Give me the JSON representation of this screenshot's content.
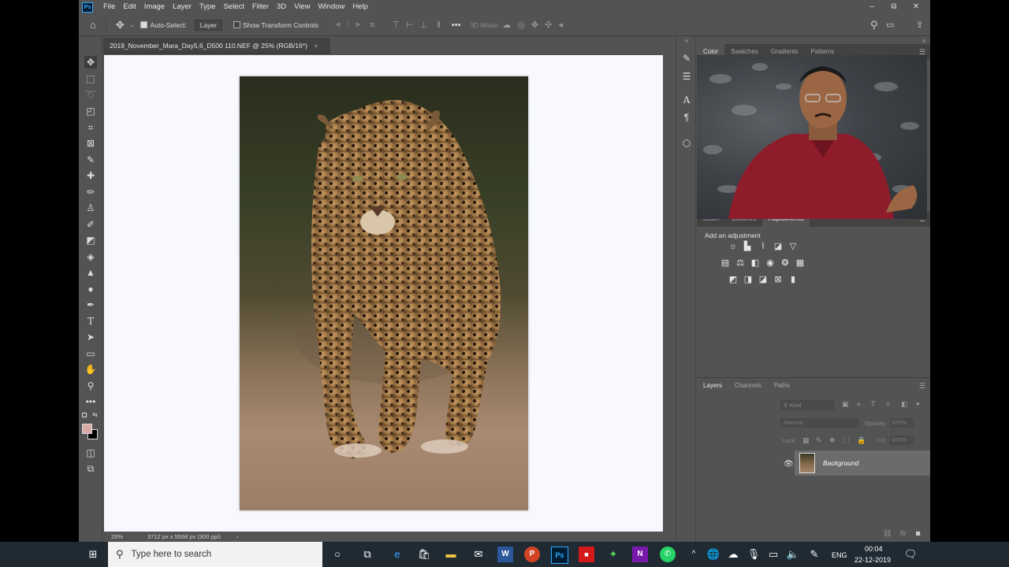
{
  "app": {
    "logo": "Ps",
    "menu": [
      "File",
      "Edit",
      "Image",
      "Layer",
      "Type",
      "Select",
      "Filter",
      "3D",
      "View",
      "Window",
      "Help"
    ],
    "window_controls": [
      "–",
      "⧉",
      "✕"
    ]
  },
  "options_bar": {
    "auto_select_label": "Auto-Select:",
    "auto_select_value": "Layer",
    "show_transform_label": "Show Transform Controls",
    "mode_3d_label": "3D Mode:",
    "more": "•••"
  },
  "document": {
    "tab_title": "2019_November_Mara_Day5,6_D500 110.NEF @ 25% (RGB/16*)",
    "tab_close": "×",
    "zoom": "25%",
    "info": "3712 px x 5568 px (300 ppi)",
    "info_arrow": "›"
  },
  "panels": {
    "color_tabs": [
      "Color",
      "Swatches",
      "Gradients",
      "Patterns"
    ],
    "adj_tabs": [
      "Learn",
      "Libraries",
      "Adjustments"
    ],
    "add_adjustment": "Add an adjustment",
    "layers_tabs": [
      "Layers",
      "Channels",
      "Paths"
    ],
    "kind_placeholder": "Kind",
    "blend_mode": "Normal",
    "opacity_label": "Opacity:",
    "opacity_value": "100%",
    "lock_label": "Lock:",
    "fill_label": "Fill:",
    "fill_value": "100%",
    "layer_name": "Background"
  },
  "taskbar": {
    "search_placeholder": "Type here to search",
    "language": "ENG",
    "time": "00:04",
    "date": "22-12-2019"
  },
  "colors": {
    "ps_bg": "#535353",
    "ps_dark": "#424242",
    "ps_blue": "#31a8ff",
    "foreground_swatch": "#d9a9a7",
    "taskbar": "#1f2a33"
  }
}
